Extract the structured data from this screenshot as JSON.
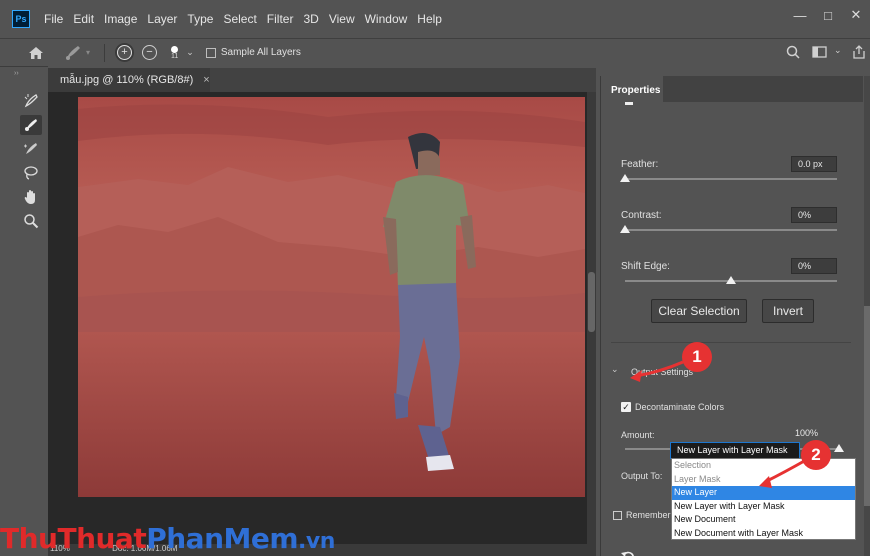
{
  "app": {
    "logo": "Ps"
  },
  "menu": [
    "File",
    "Edit",
    "Image",
    "Layer",
    "Type",
    "Select",
    "Filter",
    "3D",
    "View",
    "Window",
    "Help"
  ],
  "window_controls": [
    "—",
    "□",
    "✕"
  ],
  "options_bar": {
    "brush_size": "11",
    "sample_all_layers": "Sample All Layers"
  },
  "document": {
    "tab_title": "mẫu.jpg @ 110% (RGB/8#)",
    "close": "×",
    "zoom": "110%",
    "doc_info": "Doc: 1.06M/1.06M"
  },
  "properties": {
    "tab": "Properties",
    "feather_label": "Feather:",
    "feather_value": "0.0 px",
    "feather_level": 0,
    "contrast_label": "Contrast:",
    "contrast_value": "0%",
    "contrast_level": 0,
    "shift_edge_label": "Shift Edge:",
    "shift_edge_value": "0%",
    "shift_edge_level": 0.5,
    "clear_selection": "Clear Selection",
    "invert": "Invert",
    "output_settings": "Output Settings",
    "decontaminate": "Decontaminate Colors",
    "decontaminate_checked": true,
    "amount_label": "Amount:",
    "amount_value": "100%",
    "amount_level": 1.0,
    "output_to_label": "Output To:",
    "output_to_value": "New Layer with Layer Mask",
    "remember": "Remember S"
  },
  "dropdown_options": [
    {
      "label": "Selection",
      "state": "disabled"
    },
    {
      "label": "Layer Mask",
      "state": "disabled"
    },
    {
      "label": "New Layer",
      "state": "highlighted"
    },
    {
      "label": "New Layer with Layer Mask",
      "state": "normal"
    },
    {
      "label": "New Document",
      "state": "normal"
    },
    {
      "label": "New Document with Layer Mask",
      "state": "normal"
    }
  ],
  "annotations": {
    "badge1": "1",
    "badge2": "2",
    "color": "#e63232"
  },
  "watermark": {
    "part1": "Thu",
    "part2": "Thuat",
    "part3": "PhanMem",
    "part4": ".vn"
  },
  "colors": {
    "accent": "#1d77cf",
    "highlight": "#2f86e4",
    "panel": "#535353",
    "canvas_bg": "#282828"
  }
}
